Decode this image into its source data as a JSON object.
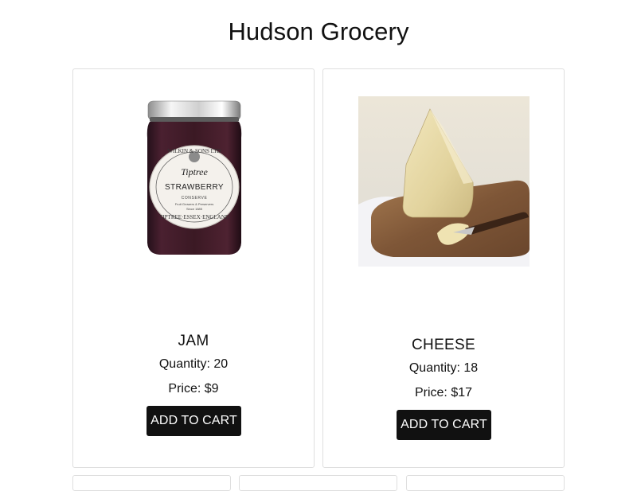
{
  "app": {
    "title": "Hudson Grocery"
  },
  "products": [
    {
      "name": "JAM",
      "quantity_text": "Quantity: 20",
      "price_text": "Price: $9",
      "button_label": "ADD TO CART",
      "image_icon": "jam-jar-image",
      "label_text": {
        "maker": "WILKIN & SONS LTD",
        "brand": "Tiptree",
        "flavor": "STRAWBERRY",
        "type": "CONSERVE",
        "line1": "Fruit Growers & Preservers",
        "line2": "Since 1885",
        "place": "TIPTREE·ESSEX·ENGLAND"
      }
    },
    {
      "name": "CHEESE",
      "quantity_text": "Quantity: 18",
      "price_text": "Price: $17",
      "button_label": "ADD TO CART",
      "image_icon": "cheese-wedge-image"
    }
  ],
  "colors": {
    "button_bg": "#111111",
    "button_text": "#ffffff",
    "card_border": "#dedede",
    "jam_color": "#3a1822",
    "cheese_color": "#e6d8a6",
    "board_color": "#8a6342"
  }
}
